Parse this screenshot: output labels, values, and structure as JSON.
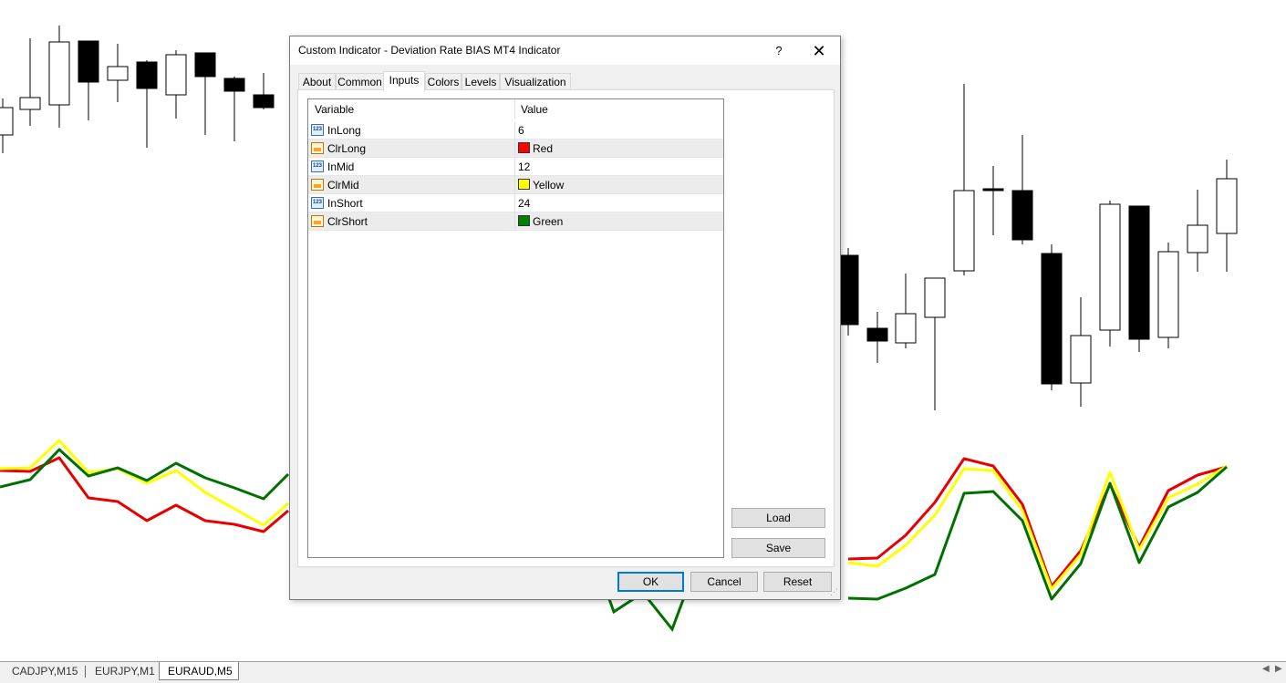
{
  "dialog": {
    "title": "Custom Indicator - Deviation Rate BIAS MT4 Indicator",
    "help_label": "?",
    "close_label": "✕",
    "tabs": [
      "About",
      "Common",
      "Inputs",
      "Colors",
      "Levels",
      "Visualization"
    ],
    "active_tab": "Inputs",
    "grid": {
      "headers": [
        "Variable",
        "Value"
      ],
      "rows": [
        {
          "icon": "integer-icon",
          "variable": "InLong",
          "value": "6",
          "swatch": null
        },
        {
          "icon": "color-icon",
          "variable": "ClrLong",
          "value": "Red",
          "swatch": "#ff0000"
        },
        {
          "icon": "integer-icon",
          "variable": "InMid",
          "value": "12",
          "swatch": null
        },
        {
          "icon": "color-icon",
          "variable": "ClrMid",
          "value": "Yellow",
          "swatch": "#ffff00"
        },
        {
          "icon": "integer-icon",
          "variable": "InShort",
          "value": "24",
          "swatch": null
        },
        {
          "icon": "color-icon",
          "variable": "ClrShort",
          "value": "Green",
          "swatch": "#008000"
        }
      ]
    },
    "load_label": "Load",
    "save_label": "Save",
    "ok_label": "OK",
    "cancel_label": "Cancel",
    "reset_label": "Reset"
  },
  "chart_tabs": [
    "CADJPY,M15",
    "EURJPY,M1",
    "EURAUD,M5"
  ],
  "active_chart_tab": "EURAUD,M5",
  "colors": {
    "bull_candle": "#ffffff",
    "bear_candle": "#000000",
    "line_long": "#e60000",
    "line_mid": "#ffff00",
    "line_short": "#007000",
    "accent": "#0078d7"
  }
}
